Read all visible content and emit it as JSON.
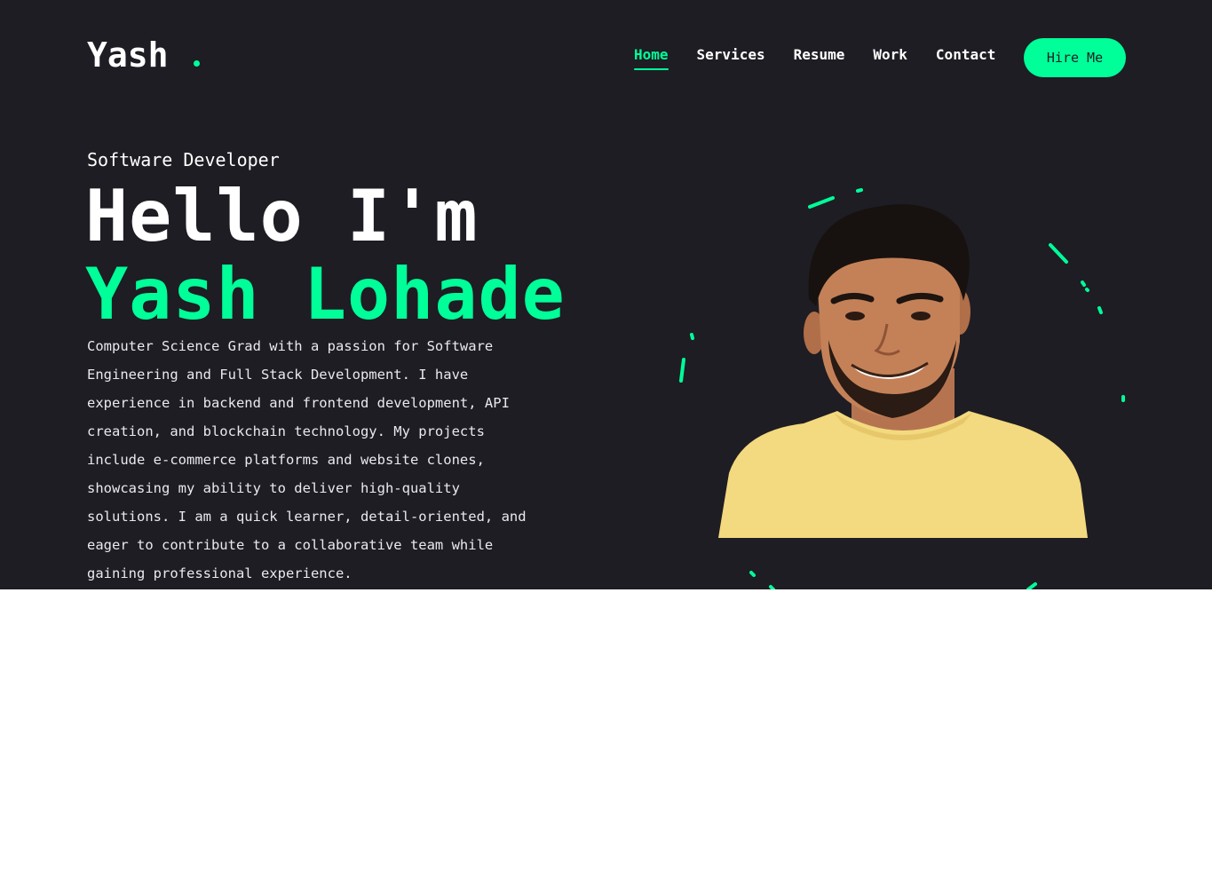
{
  "header": {
    "logo": "Yash",
    "nav": [
      {
        "label": "Home",
        "active": true
      },
      {
        "label": "Services",
        "active": false
      },
      {
        "label": "Resume",
        "active": false
      },
      {
        "label": "Work",
        "active": false
      },
      {
        "label": "Contact",
        "active": false
      }
    ],
    "hire_label": "Hire Me"
  },
  "hero": {
    "role": "Software Developer",
    "greeting": "Hello I'm",
    "name": "Yash Lohade",
    "bio": "Computer Science Grad with a passion for Software Engineering and Full Stack Development. I have experience in backend and frontend development, API creation, and blockchain technology. My projects include e-commerce platforms and website clones, showcasing my ability to deliver high-quality solutions. I am a quick learner, detail-oriented, and eager to contribute to a collaborative team while gaining professional experience."
  },
  "colors": {
    "background": "#1e1d23",
    "accent": "#00ff99",
    "text": "#ffffff",
    "page": "#ffffff"
  }
}
